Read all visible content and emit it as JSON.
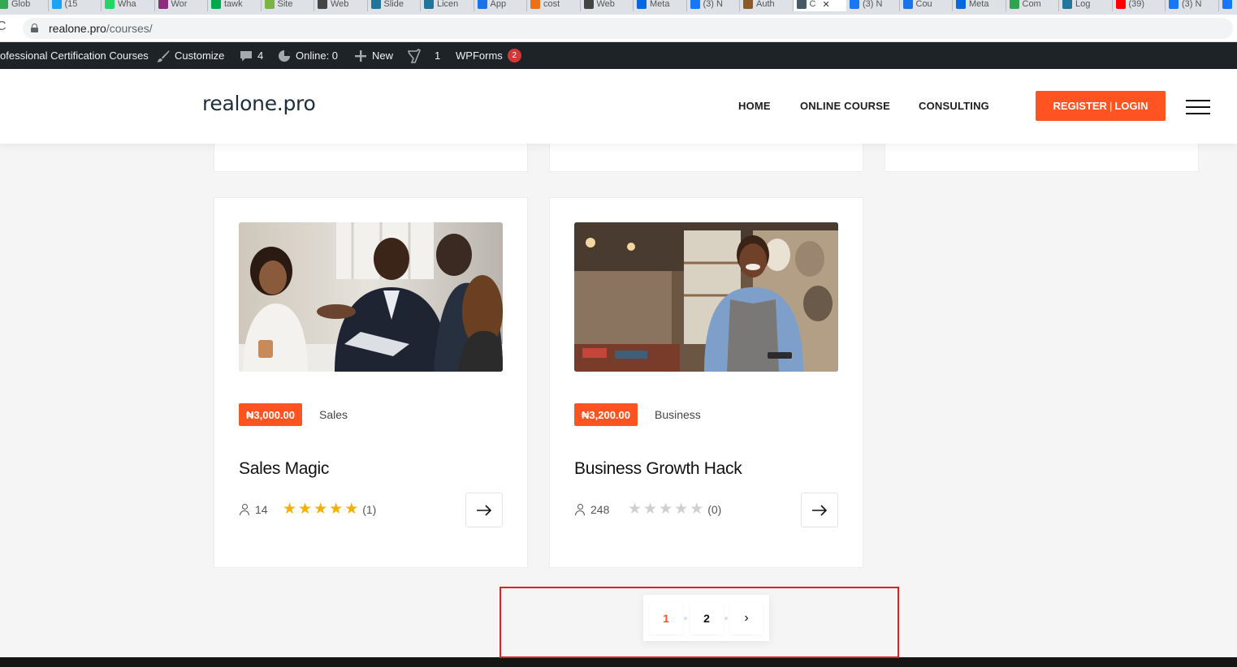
{
  "browser": {
    "tabs": [
      {
        "label": "Glob",
        "color": "#34a853"
      },
      {
        "label": "(15",
        "color": "#1da1f2"
      },
      {
        "label": "Wha",
        "color": "#25d366"
      },
      {
        "label": "Wor",
        "color": "#8b2c7c"
      },
      {
        "label": "tawk",
        "color": "#03a84e"
      },
      {
        "label": "Site",
        "color": "#7cb342"
      },
      {
        "label": "Web",
        "color": "#444444"
      },
      {
        "label": "Slide",
        "color": "#21759b"
      },
      {
        "label": "Licen",
        "color": "#21759b"
      },
      {
        "label": "App",
        "color": "#1a73e8"
      },
      {
        "label": "cost",
        "color": "#e8711a"
      },
      {
        "label": "Web",
        "color": "#444444"
      },
      {
        "label": "Meta",
        "color": "#0668e1"
      },
      {
        "label": "(3) N",
        "color": "#1877f2"
      },
      {
        "label": "Auth",
        "color": "#8a5a2b"
      },
      {
        "label": "C",
        "color": "#455a64"
      },
      {
        "label": "(3) N",
        "color": "#1877f2"
      },
      {
        "label": "Cou",
        "color": "#1a73e8"
      },
      {
        "label": "Meta",
        "color": "#0668e1"
      },
      {
        "label": "Com",
        "color": "#2ea44f"
      },
      {
        "label": "Log",
        "color": "#21759b"
      },
      {
        "label": "(39)",
        "color": "#ff0000"
      },
      {
        "label": "(3) N",
        "color": "#1877f2"
      },
      {
        "label": "",
        "color": "#1877f2"
      }
    ],
    "active_tab_close": "✕",
    "url_host": "realone.pro",
    "url_path": "/courses/"
  },
  "admin_bar": {
    "site_name": "ofessional Certification Courses",
    "customize": "Customize",
    "comments_count": "4",
    "online": "Online: 0",
    "new": "New",
    "seo_count": "1",
    "wpforms": "WPForms",
    "wpforms_badge": "2"
  },
  "header": {
    "logo": "realone.pro",
    "nav": [
      "HOME",
      "ONLINE COURSE",
      "CONSULTING"
    ],
    "register": "REGISTER",
    "login": "LOGIN",
    "separator": "|"
  },
  "courses": [
    {
      "price": "₦3,000.00",
      "category": "Sales",
      "title": "Sales Magic",
      "students": "14",
      "rating": 5,
      "reviews": "(1)",
      "image": "business-meeting-photo"
    },
    {
      "price": "₦3,200.00",
      "category": "Business",
      "title": "Business Growth Hack",
      "students": "248",
      "rating": 0,
      "reviews": "(0)",
      "image": "shop-owner-photo"
    }
  ],
  "pagination": {
    "pages": [
      "1",
      "2"
    ],
    "current": "1",
    "next": "›"
  }
}
